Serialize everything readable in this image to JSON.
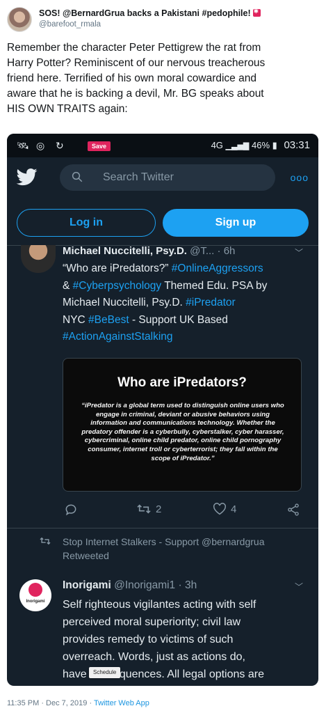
{
  "outer_tweet": {
    "display_name": "SOS! @BernardGrua backs a Pakistani #pedophile!",
    "handle": "@barefoot_rmala",
    "text_lines": [
      "Remember the character Peter Pettigrew the rat from",
      "Harry Potter? Reminiscent of our nervous treacherous",
      "friend here. Terrified of his own moral cowardice and",
      "aware that he is backing a devil, Mr. BG speaks about",
      "HIS OWN TRAITS again:"
    ],
    "timestamp": "11:35 PM · Dec 7, 2019",
    "source": "Twitter Web App"
  },
  "phone": {
    "status_bar": {
      "save_label": "Save",
      "network": "4G",
      "battery": "46%",
      "time": "03:31"
    },
    "search": {
      "placeholder": "Search Twitter"
    },
    "auth": {
      "login": "Log in",
      "signup": "Sign up"
    },
    "tweet1": {
      "name": "Michael Nuccitelli, Psy.D.",
      "handle": "@T...",
      "time": "6h",
      "text_parts": [
        "“Who are iPredators?” ",
        "#OnlineAggressors",
        "& ",
        "#Cyberpsychology",
        " Themed   Edu. PSA by Michael Nuccitelli, Psy.D. ",
        "#iPredator",
        " NYC ",
        "#BeBest",
        " - Support UK Based ",
        "#ActionAgainstStalking"
      ],
      "media": {
        "title": "Who are iPredators?",
        "body": "“iPredator is a global term used to distinguish online users who engage in criminal, deviant or abusive behaviors using information and communications technology. Whether the predatory offender is a cyberbully, cyberstalker, cyber harasser, cybercriminal, online child predator, online child pornography consumer, internet troll or cyberterrorist; they fall within the scope of iPredator.”"
      },
      "retweets": "2",
      "likes": "4"
    },
    "retweeted_by": "Stop Internet Stalkers - Support @bernardgrua Retweeted",
    "tweet2": {
      "name": "Inorigami",
      "handle": "@Inorigami1",
      "time": "3h",
      "avatar_label": "Inorigami",
      "text_lines": [
        "Self righteous vigilantes acting with self",
        "perceived moral superiority; civil law",
        "provides remedy to  victims of such",
        "overreach. Words, just as actions do,",
        "have consequences. All legal options are"
      ]
    },
    "schedule_chip": "Schedule"
  },
  "colors": {
    "twitter_blue": "#1da1f2",
    "dark_bg": "#15202b",
    "save_red": "#e0245e"
  }
}
